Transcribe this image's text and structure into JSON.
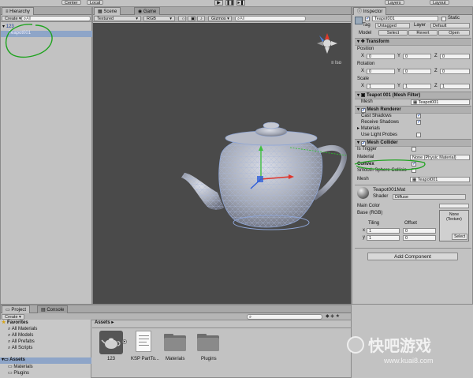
{
  "toolbar_top": {
    "center_label": "Center",
    "local_label": "Local",
    "layers_label": "Layers",
    "layout_label": "Layout"
  },
  "hierarchy": {
    "tab": "Hierarchy",
    "create": "Create",
    "search_placeholder": "All",
    "items": [
      "123",
      "Teapot001"
    ]
  },
  "scene": {
    "tab_scene": "Scene",
    "tab_game": "Game",
    "render_mode": "Textured",
    "color_mode": "RGB",
    "gizmos": "Gizmos",
    "search_placeholder": "All",
    "gizmo_label": "Iso"
  },
  "inspector": {
    "tab": "Inspector",
    "object_name": "Teapot001",
    "static_label": "Static",
    "tag_label": "Tag",
    "tag_value": "Untagged",
    "layer_label": "Layer",
    "layer_value": "Default",
    "model_label": "Model",
    "model_buttons": [
      "Select",
      "Revert",
      "Open"
    ],
    "transform": {
      "title": "Transform",
      "position_label": "Position",
      "rotation_label": "Rotation",
      "scale_label": "Scale",
      "position": {
        "x": "0",
        "y": "0",
        "z": "0"
      },
      "rotation": {
        "x": "0",
        "y": "0",
        "z": "0"
      },
      "scale": {
        "x": "1",
        "y": "1",
        "z": "1"
      }
    },
    "mesh_filter": {
      "title": "Teapot 001 (Mesh Filter)",
      "mesh_label": "Mesh",
      "mesh_value": "Teapot001"
    },
    "mesh_renderer": {
      "title": "Mesh Renderer",
      "cast_shadows": "Cast Shadows",
      "receive_shadows": "Receive Shadows",
      "materials": "Materials",
      "use_light_probes": "Use Light Probes"
    },
    "mesh_collider": {
      "title": "Mesh Collider",
      "is_trigger": "Is Trigger",
      "material_label": "Material",
      "material_value": "None (Physic Material)",
      "convex": "Convex",
      "smooth": "Smooth Sphere Collisio",
      "mesh_label": "Mesh",
      "mesh_value": "Teapot001"
    },
    "material": {
      "name": "Teapot001Mat",
      "shader_label": "Shader",
      "shader_value": "Diffuse",
      "main_color": "Main Color",
      "base_rgb": "Base (RGB)",
      "tiling": "Tiling",
      "offset": "Offset",
      "x_tiling": "1",
      "x_offset": "0",
      "y_tiling": "1",
      "y_offset": "0",
      "texture_none": "None\n(Texture)",
      "select": "Select"
    },
    "add_component": "Add Component"
  },
  "project": {
    "tab_project": "Project",
    "tab_console": "Console",
    "create": "Create",
    "favorites": "Favorites",
    "favorite_items": [
      "All Materials",
      "All Models",
      "All Prefabs",
      "All Scripts"
    ],
    "assets_root": "Assets",
    "tree_items": [
      "Materials",
      "Plugins"
    ],
    "breadcrumb": "Assets",
    "assets": [
      {
        "name": "123",
        "kind": "model"
      },
      {
        "name": "KSP PartTo...",
        "kind": "doc"
      },
      {
        "name": "Materials",
        "kind": "folder"
      },
      {
        "name": "Plugins",
        "kind": "folder"
      }
    ]
  },
  "watermark": {
    "brand": "快吧游戏",
    "url": "www.kuai8.com"
  },
  "colors": {
    "scene_bg": "#4a4a4a",
    "selection": "#8ea5c8",
    "annotation_green": "#1fa31f"
  }
}
